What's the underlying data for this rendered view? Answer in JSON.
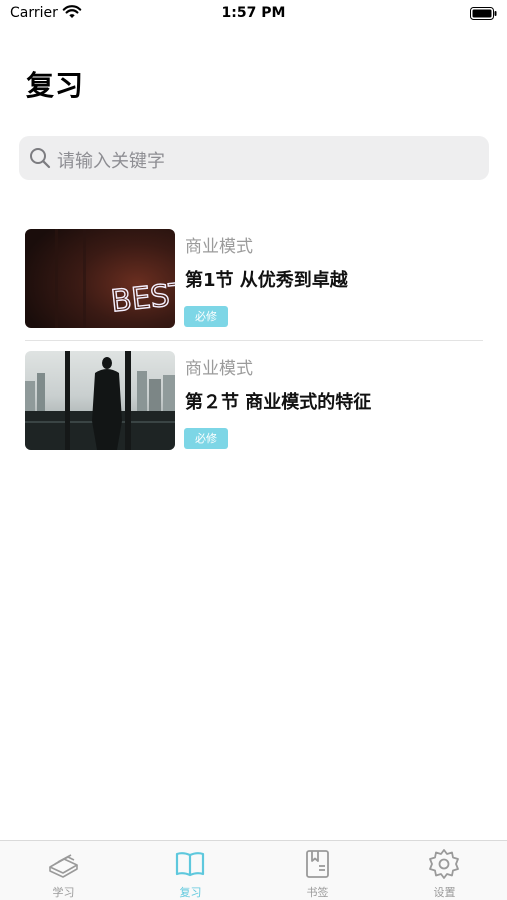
{
  "status_bar": {
    "carrier": "Carrier",
    "time": "1:57 PM"
  },
  "header": {
    "title": "复习"
  },
  "search": {
    "placeholder": "请输入关键字",
    "icon": "search-icon"
  },
  "lessons": [
    {
      "category": "商业模式",
      "title": "第1节 从优秀到卓越",
      "badge": "必修",
      "thumbnail_text": "BEST"
    },
    {
      "category": "商业模式",
      "title": "第２节 商业模式的特征",
      "badge": "必修"
    }
  ],
  "tab_bar": {
    "tabs": [
      {
        "label": "学习",
        "icon": "book-stack-icon"
      },
      {
        "label": "复习",
        "icon": "open-book-icon"
      },
      {
        "label": "书签",
        "icon": "bookmark-book-icon"
      },
      {
        "label": "设置",
        "icon": "gear-icon"
      }
    ],
    "active_color": "#5ec8dd",
    "inactive_color": "#9a9a9a"
  },
  "colors": {
    "badge": "#7dd6e6",
    "search_background": "#eeeeef"
  }
}
